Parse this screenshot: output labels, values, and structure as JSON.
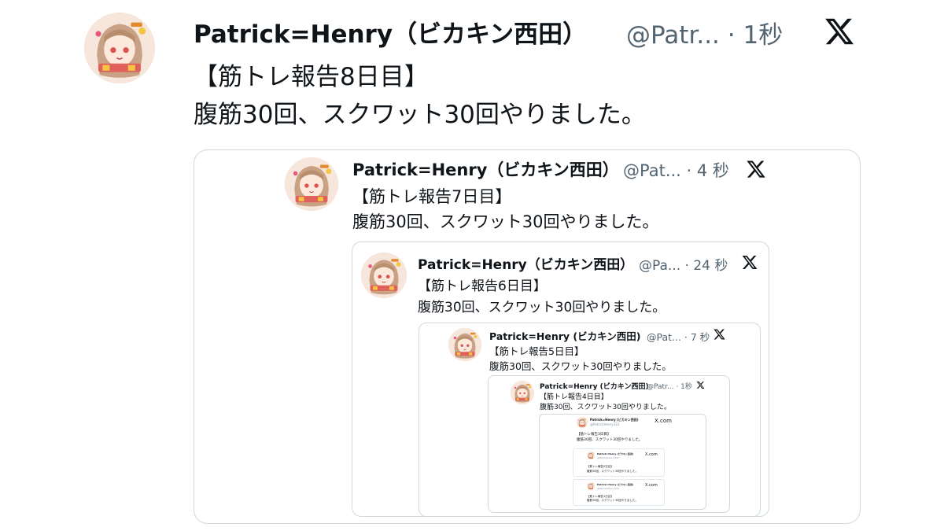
{
  "post": {
    "name": "Patrick=Henry（ビカキン西田）",
    "handle_time": "@Patr... · 1秒",
    "line1": "【筋トレ報告8日目】",
    "line2": "腹筋30回、スクワット30回やりました。"
  },
  "quote1": {
    "name": "Patrick=Henry（ビカキン西田）",
    "handle_time": "@Pat... · 4 秒",
    "line1": "【筋トレ報告7日目】",
    "line2": "腹筋30回、スクワット30回やりました。"
  },
  "quote2": {
    "name": "Patrick=Henry（ビカキン西田）",
    "handle_time": "@Pa... · 24 秒",
    "line1": "【筋トレ報告6日目】",
    "line2": "腹筋30回、スクワット30回やりました。"
  },
  "quote3": {
    "name": "Patrick=Henry (ビカキン西田)",
    "handle_time": "@Pat... · 7 秒",
    "line1": "【筋トレ報告5日目】",
    "line2": "腹筋30回、スクワット30回やりました。"
  },
  "quote4": {
    "name": "Patrick=Henry (ビカキン西田)",
    "handle_time": "@Patr... · 1秒",
    "line1": "【筋トレ報告4日目】",
    "line2": "腹筋30回、スクワット30回やりました。"
  },
  "quote5": {
    "name": "Patrick=Henry (ビカキン西田)",
    "handle": "@PatrickHenry333",
    "brand": "X.com",
    "line1": "【筋トレ報告3日目】",
    "line2": "腹筋30回、スクワット30回やりました。"
  },
  "quote6": {
    "name": "Patrick=Henry (ビカキン西田)",
    "handle": "@PatrickHenry333",
    "brand": "X.com",
    "line1": "【筋トレ報告2日目】",
    "line2": "腹筋30回、スクワット30回やりました。"
  },
  "quote7": {
    "name": "Patrick=Henry (ビカキン西田)",
    "handle": "@PatrickHenry333",
    "brand": "X.com",
    "line1": "【筋トレ報告1日目】",
    "line2": "腹筋30回、スクワット30回やりました。"
  },
  "icons": {
    "x_logo": "x-logo-icon",
    "avatar": "anime-character-avatar"
  },
  "colors": {
    "text": "#0f1419",
    "secondary": "#536471",
    "border": "#cfd9de"
  }
}
